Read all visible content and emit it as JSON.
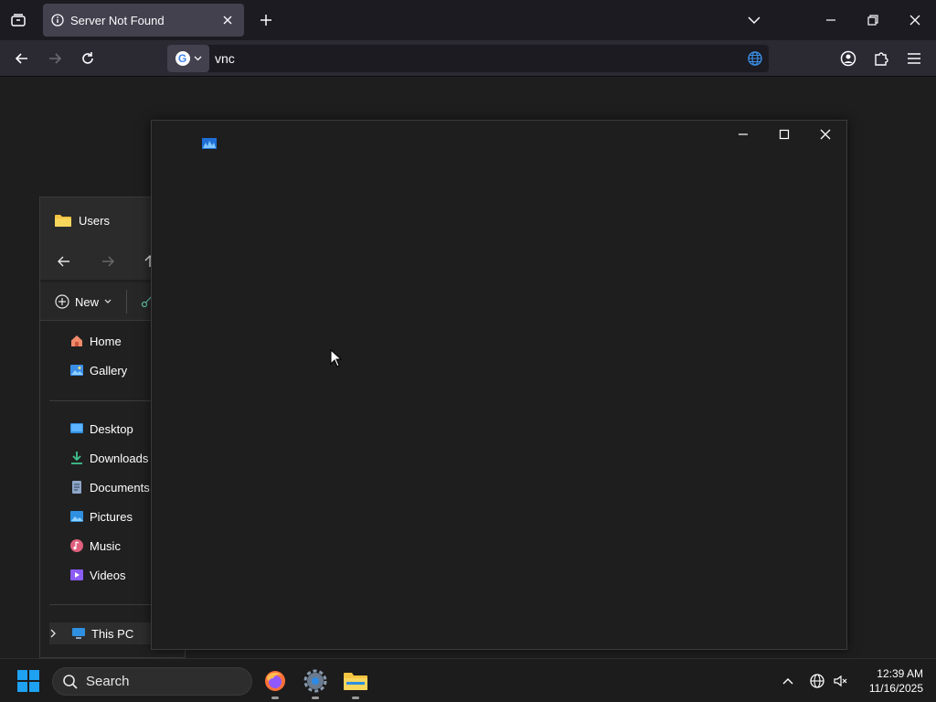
{
  "browser": {
    "tab": {
      "title": "Server Not Found"
    },
    "urlbar": {
      "value": "vnc",
      "search_engine": "G"
    }
  },
  "explorer": {
    "title": "Users",
    "new_label": "New",
    "nav_group1": [
      {
        "label": "Home",
        "icon": "home-icon"
      },
      {
        "label": "Gallery",
        "icon": "gallery-icon"
      }
    ],
    "nav_group2": [
      {
        "label": "Desktop",
        "icon": "desktop-icon"
      },
      {
        "label": "Downloads",
        "icon": "downloads-icon"
      },
      {
        "label": "Documents",
        "icon": "documents-icon"
      },
      {
        "label": "Pictures",
        "icon": "pictures-icon"
      },
      {
        "label": "Music",
        "icon": "music-icon"
      },
      {
        "label": "Videos",
        "icon": "videos-icon"
      }
    ],
    "this_pc": "This PC"
  },
  "taskbar": {
    "search_label": "Search",
    "time": "12:39 AM",
    "date": "11/16/2025"
  },
  "colors": {
    "folder": "#f4c542",
    "accent": "#3a8ee6",
    "windows_blue": "#1ea1f1"
  }
}
